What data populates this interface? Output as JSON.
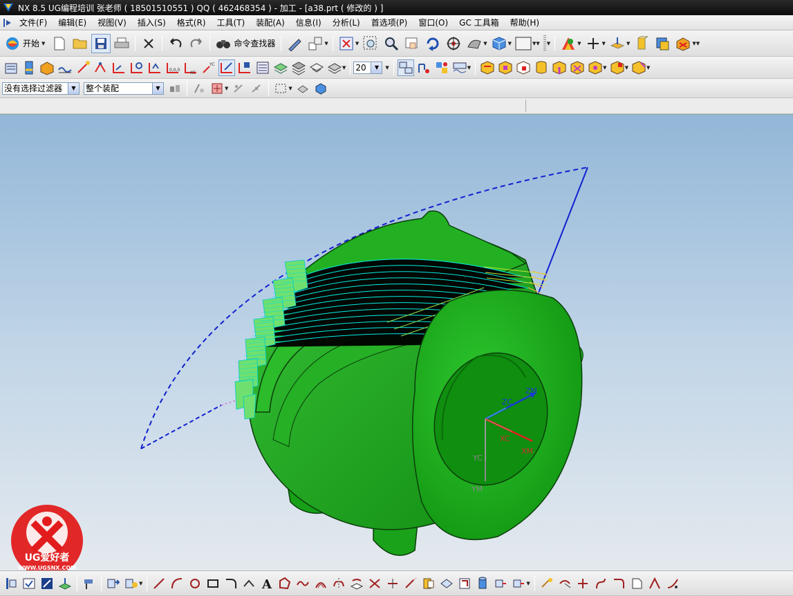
{
  "window": {
    "title": "NX 8.5  UG编程培训 张老师 ( 18501510551 ) QQ ( 462468354 ) - 加工 - [a38.prt ( 修改的 ) ]"
  },
  "menu": {
    "items": [
      "文件(F)",
      "编辑(E)",
      "视图(V)",
      "插入(S)",
      "格式(R)",
      "工具(T)",
      "装配(A)",
      "信息(I)",
      "分析(L)",
      "首选项(P)",
      "窗口(O)",
      "GC 工具箱",
      "帮助(H)"
    ]
  },
  "toolbar": {
    "start_label": "开始",
    "command_finder_label": "命令查找器",
    "layer_value": "20"
  },
  "selection_bar": {
    "filter_value": "没有选择过滤器",
    "scope_value": "整个装配"
  },
  "viewport": {
    "csys_labels": {
      "zm": "ZM",
      "zc": "ZC",
      "xc": "XC",
      "xm": "XM",
      "yc": "YC",
      "ym": "YM"
    },
    "colors": {
      "part": "#1fa01f",
      "toolpath": "#00f0f0",
      "boundary": "#1020d0"
    }
  },
  "watermark": {
    "brand": "UG爱好者",
    "url": "WWW.UGSNX.COM"
  }
}
